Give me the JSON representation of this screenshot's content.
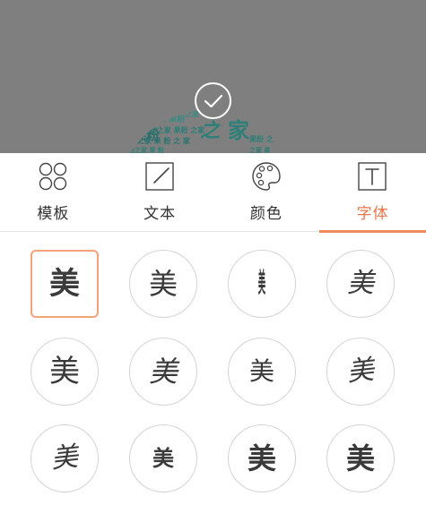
{
  "preview": {
    "wordcloud_words": [
      "果粉",
      "之家",
      "果粉之家"
    ],
    "confirm_icon": "check-circle-icon"
  },
  "tabs": [
    {
      "label": "模板",
      "icon": "template-icon",
      "active": false
    },
    {
      "label": "文本",
      "icon": "text-edit-icon",
      "active": false
    },
    {
      "label": "颜色",
      "icon": "palette-icon",
      "active": false
    },
    {
      "label": "字体",
      "icon": "font-icon",
      "active": true
    }
  ],
  "font_options": [
    {
      "glyph": "美",
      "selected": true
    },
    {
      "glyph": "美",
      "selected": false
    },
    {
      "glyph": "美",
      "selected": false
    },
    {
      "glyph": "美",
      "selected": false
    },
    {
      "glyph": "美",
      "selected": false
    },
    {
      "glyph": "美",
      "selected": false
    },
    {
      "glyph": "美",
      "selected": false
    },
    {
      "glyph": "美",
      "selected": false
    },
    {
      "glyph": "美",
      "selected": false
    },
    {
      "glyph": "美",
      "selected": false
    },
    {
      "glyph": "美",
      "selected": false
    },
    {
      "glyph": "美",
      "selected": false
    }
  ],
  "colors": {
    "preview_bg": "#7f7f7f",
    "wordcloud": "#2e7f78",
    "accent": "#f08a5d",
    "text": "#333333"
  }
}
